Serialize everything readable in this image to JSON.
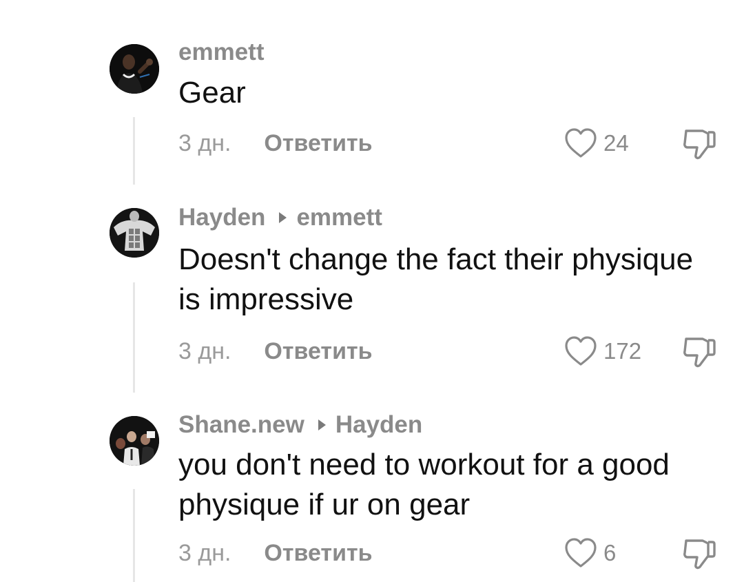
{
  "comments": [
    {
      "author": "emmett",
      "reply_to": "",
      "text": "Gear",
      "time": "3 дн.",
      "reply_label": "Ответить",
      "likes": "24",
      "avatar_icon": "person-waving-avatar"
    },
    {
      "author": "Hayden",
      "reply_to": "emmett",
      "text": "Doesn't change the fact their physique is impressive",
      "time": "3 дн.",
      "reply_label": "Ответить",
      "likes": "172",
      "avatar_icon": "muscular-torso-avatar"
    },
    {
      "author": "Shane.new",
      "reply_to": "Hayden",
      "text": "you don't need to workout for a good physique if ur on gear",
      "time": "3 дн.",
      "reply_label": "Ответить",
      "likes": "6",
      "avatar_icon": "group-photo-avatar"
    }
  ],
  "colors": {
    "author": "#8a8a8a",
    "body_text": "#111111",
    "time": "#9a9a9a",
    "icon": "#8a8a8a",
    "thread_line": "#e6e6e6"
  }
}
